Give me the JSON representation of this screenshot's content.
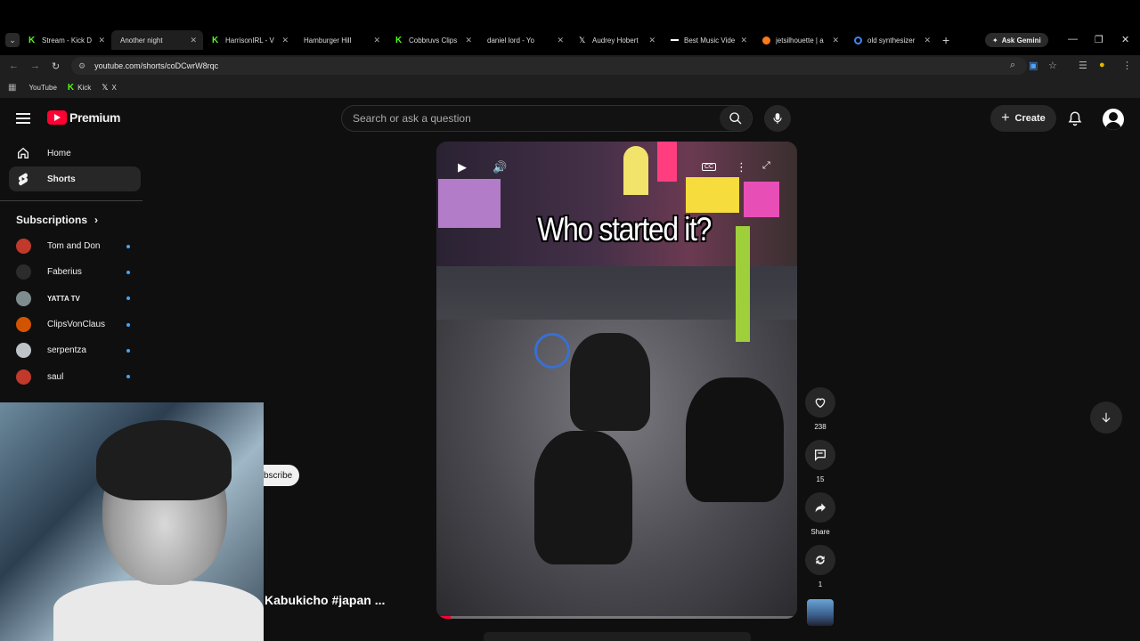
{
  "browser": {
    "tabs": [
      {
        "title": "Stream - Kick D",
        "icon": "kick-icon"
      },
      {
        "title": "Another night",
        "icon": "youtube-icon",
        "active": true
      },
      {
        "title": "HarrisonIRL - V",
        "icon": "kick-icon"
      },
      {
        "title": "Hamburger Hill",
        "icon": "youtube-icon"
      },
      {
        "title": "Cobbruvs Clips",
        "icon": "kick-icon"
      },
      {
        "title": "daniel lord - Yo",
        "icon": "youtube-icon"
      },
      {
        "title": "Audrey Hobert",
        "icon": "x-icon"
      },
      {
        "title": "Best Music Vide",
        "icon": "music-icon"
      },
      {
        "title": "jetsilhouette | a",
        "icon": "firefox-icon"
      },
      {
        "title": "old synthesizer",
        "icon": "google-icon"
      }
    ],
    "gemini_label": "Ask Gemini",
    "url": "youtube.com/shorts/coDCwrW8rqc",
    "bookmarks": [
      {
        "label": "YouTube",
        "icon": "youtube-icon"
      },
      {
        "label": "Kick",
        "icon": "kick-icon"
      },
      {
        "label": "X",
        "icon": "x-icon"
      }
    ]
  },
  "youtube": {
    "logo_text": "Premium",
    "search_placeholder": "Search or ask a question",
    "create_label": "Create",
    "nav": [
      {
        "label": "Home",
        "icon": "home-icon"
      },
      {
        "label": "Shorts",
        "icon": "shorts-icon",
        "active": true
      }
    ],
    "subscriptions_heading": "Subscriptions",
    "subscriptions": [
      {
        "name": "Tom and Don",
        "color": "#c0392b"
      },
      {
        "name": "Faberius",
        "color": "#2c2c2c"
      },
      {
        "name": "YATTA TV",
        "color": "#7f8c8d"
      },
      {
        "name": "ClipsVonClaus",
        "color": "#d35400"
      },
      {
        "name": "serpentza",
        "color": "#bdc3c7"
      },
      {
        "name": "saul",
        "color": "#c0392b"
      }
    ],
    "short": {
      "caption": "Who started it?",
      "subscribe_fragment": "bscribe",
      "title_fragment": "Kabukicho #japan ...",
      "progress_fraction": 0.04
    },
    "actions": {
      "likes": "238",
      "comments": "15",
      "share_label": "Share",
      "remix_count": "1"
    }
  },
  "colors": {
    "accent": "#ff0033",
    "kick": "#53fc18",
    "link": "#3ea6ff"
  }
}
